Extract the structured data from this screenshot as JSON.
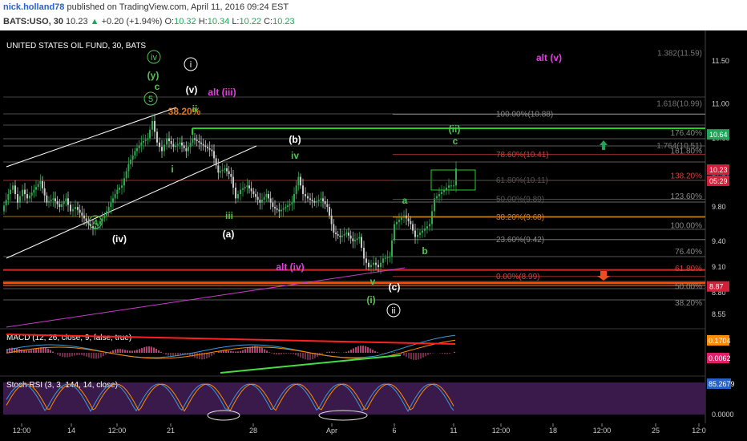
{
  "header": {
    "author": "nick.holland78",
    "published_text": "published on TradingView.com, April 11, 2016 09:24 EST",
    "symbol": "BATS:USO, 30",
    "last": "10.23",
    "change_arrow": "▲",
    "change": "+0.20 (+1.94%)",
    "o_label": "O:",
    "o": "10.32",
    "h_label": "H:",
    "h": "10.34",
    "l_label": "L:",
    "l": "10.22",
    "c_label": "C:",
    "c": "10.23"
  },
  "chart_data": {
    "type": "candlestick",
    "title": "UNITED STATES OIL FUND, 30, BATS",
    "y_ticks": [
      "11.50",
      "11.00",
      "10.60",
      "10.20",
      "9.80",
      "9.40",
      "9.10",
      "8.80",
      "8.55"
    ],
    "x_ticks": [
      "12:00",
      "14",
      "12:00",
      "21",
      "28",
      "Apr",
      "6",
      "11",
      "12:00",
      "18",
      "12:00",
      "25",
      "12:0"
    ],
    "price_path": [
      [
        0,
        9.75
      ],
      [
        8,
        9.95
      ],
      [
        14,
        10.05
      ],
      [
        20,
        9.85
      ],
      [
        26,
        10.0
      ],
      [
        32,
        9.9
      ],
      [
        40,
        10.0
      ],
      [
        48,
        10.1
      ],
      [
        56,
        9.85
      ],
      [
        64,
        9.9
      ],
      [
        72,
        9.8
      ],
      [
        80,
        9.9
      ],
      [
        86,
        9.75
      ],
      [
        92,
        9.8
      ],
      [
        100,
        9.7
      ],
      [
        108,
        9.6
      ],
      [
        114,
        9.55
      ],
      [
        120,
        9.6
      ],
      [
        128,
        9.7
      ],
      [
        136,
        9.85
      ],
      [
        144,
        10.0
      ],
      [
        150,
        10.05
      ],
      [
        158,
        10.3
      ],
      [
        166,
        10.45
      ],
      [
        174,
        10.55
      ],
      [
        182,
        10.6
      ],
      [
        188,
        10.8
      ],
      [
        194,
        10.55
      ],
      [
        200,
        10.45
      ],
      [
        206,
        10.6
      ],
      [
        214,
        10.5
      ],
      [
        222,
        10.55
      ],
      [
        230,
        10.45
      ],
      [
        238,
        10.6
      ],
      [
        246,
        10.55
      ],
      [
        254,
        10.5
      ],
      [
        262,
        10.45
      ],
      [
        270,
        10.2
      ],
      [
        278,
        10.25
      ],
      [
        286,
        10.15
      ],
      [
        292,
        9.9
      ],
      [
        298,
        10.0
      ],
      [
        306,
        10.05
      ],
      [
        314,
        9.95
      ],
      [
        322,
        9.85
      ],
      [
        330,
        9.95
      ],
      [
        338,
        9.8
      ],
      [
        346,
        9.75
      ],
      [
        354,
        9.8
      ],
      [
        362,
        9.85
      ],
      [
        370,
        10.15
      ],
      [
        376,
        9.95
      ],
      [
        382,
        9.9
      ],
      [
        390,
        9.85
      ],
      [
        398,
        9.9
      ],
      [
        406,
        9.8
      ],
      [
        414,
        9.5
      ],
      [
        422,
        9.45
      ],
      [
        430,
        9.5
      ],
      [
        438,
        9.4
      ],
      [
        446,
        9.45
      ],
      [
        452,
        9.2
      ],
      [
        458,
        9.1
      ],
      [
        464,
        9.15
      ],
      [
        470,
        9.1
      ],
      [
        476,
        9.2
      ],
      [
        484,
        9.22
      ],
      [
        490,
        9.6
      ],
      [
        496,
        9.65
      ],
      [
        502,
        9.7
      ],
      [
        510,
        9.6
      ],
      [
        516,
        9.45
      ],
      [
        522,
        9.5
      ],
      [
        528,
        9.55
      ],
      [
        534,
        9.6
      ],
      [
        540,
        9.9
      ],
      [
        546,
        9.95
      ],
      [
        552,
        10.0
      ],
      [
        558,
        10.05
      ],
      [
        564,
        10.05
      ],
      [
        568,
        10.25
      ]
    ],
    "fib_levels": [
      {
        "label": "100.00%(10.88)",
        "price": 10.88,
        "color": "#8a8a8a"
      },
      {
        "label": "78.60%(10.41)",
        "price": 10.41,
        "color": "#d44040"
      },
      {
        "label": "61.80%(10.11)",
        "price": 10.11,
        "color": "#555555"
      },
      {
        "label": "50.00%(9.89)",
        "price": 9.89,
        "color": "#555555"
      },
      {
        "label": "38.20%(9.68)",
        "price": 9.68,
        "color": "#e07a1f"
      },
      {
        "label": "23.60%(9.42)",
        "price": 9.42,
        "color": "#888888"
      },
      {
        "label": "0.00%(8.99)",
        "price": 8.99,
        "color": "#d44040"
      }
    ],
    "right_fib_labels": [
      {
        "label": "1.382(11.59)",
        "price": 11.59,
        "color": "#777777"
      },
      {
        "label": "1.618(10.99)",
        "price": 11.0,
        "color": "#777777"
      },
      {
        "label": "1.764(10.51)",
        "price": 10.51,
        "color": "#777777"
      },
      {
        "label": "176.40%",
        "price": 10.66,
        "color": "#8a8a8a"
      },
      {
        "label": "161.80%",
        "price": 10.45,
        "color": "#8a8a8a"
      },
      {
        "label": "138.20%",
        "price": 10.16,
        "color": "#d44040"
      },
      {
        "label": "123.60%",
        "price": 9.92,
        "color": "#8a8a8a"
      },
      {
        "label": "100.00%",
        "price": 9.58,
        "color": "#8a8a8a"
      },
      {
        "label": "76.40%",
        "price": 9.28,
        "color": "#8a8a8a"
      },
      {
        "label": "61.80%",
        "price": 9.08,
        "color": "#d44040"
      },
      {
        "label": "50.00%",
        "price": 8.87,
        "color": "#8a8a8a"
      },
      {
        "label": "38.20%",
        "price": 8.68,
        "color": "#8a8a8a"
      }
    ],
    "price_tags": [
      {
        "label": "10.64",
        "price": 10.64,
        "color": "#21a35a"
      },
      {
        "label": "10.23",
        "price": 10.23,
        "color": "#d41f3a"
      },
      {
        "label": "05:29",
        "price": 10.1,
        "color": "#d41f3a"
      },
      {
        "label": "8.87",
        "price": 8.87,
        "color": "#d41f3a"
      }
    ],
    "wave_labels": [
      {
        "text": "iv",
        "x": 192,
        "y": 75,
        "color": "#55c255",
        "circle": true
      },
      {
        "text": "i",
        "x": 238,
        "y": 84,
        "color": "#ffffff",
        "circle": true
      },
      {
        "text": "(y)",
        "x": 191,
        "y": 98,
        "color": "#55c255",
        "circle": false
      },
      {
        "text": "c",
        "x": 196,
        "y": 112,
        "color": "#55c255",
        "circle": false
      },
      {
        "text": "5",
        "x": 188,
        "y": 127,
        "color": "#55c255",
        "circle": true
      },
      {
        "text": "(v)",
        "x": 239,
        "y": 116,
        "color": "#ffffff",
        "circle": false
      },
      {
        "text": "alt (iii)",
        "x": 277,
        "y": 119,
        "color": "#e23ee0",
        "circle": false
      },
      {
        "text": "38.20%",
        "x": 230,
        "y": 143,
        "color": "#e07a1f",
        "circle": false
      },
      {
        "text": "ii",
        "x": 243,
        "y": 140,
        "color": "#55c255",
        "circle": false
      },
      {
        "text": "alt (v)",
        "x": 685,
        "y": 76,
        "color": "#e23ee0",
        "circle": false
      },
      {
        "text": "(ii)",
        "x": 567,
        "y": 165,
        "color": "#55c255",
        "circle": false
      },
      {
        "text": "c",
        "x": 568,
        "y": 180,
        "color": "#55c255",
        "circle": false
      },
      {
        "text": "(b)",
        "x": 368,
        "y": 178,
        "color": "#ffffff",
        "circle": false
      },
      {
        "text": "iv",
        "x": 368,
        "y": 198,
        "color": "#55c255",
        "circle": false
      },
      {
        "text": "i",
        "x": 215,
        "y": 215,
        "color": "#55c255",
        "circle": false
      },
      {
        "text": "iii",
        "x": 286,
        "y": 273,
        "color": "#55c255",
        "circle": false
      },
      {
        "text": "4",
        "x": 119,
        "y": 281,
        "color": "#55c255",
        "circle": true
      },
      {
        "text": "a",
        "x": 505,
        "y": 254,
        "color": "#55c255",
        "circle": false
      },
      {
        "text": "(iv)",
        "x": 149,
        "y": 302,
        "color": "#ffffff",
        "circle": false
      },
      {
        "text": "(a)",
        "x": 285,
        "y": 296,
        "color": "#ffffff",
        "circle": false
      },
      {
        "text": "b",
        "x": 530,
        "y": 317,
        "color": "#55c255",
        "circle": false
      },
      {
        "text": "alt (iv)",
        "x": 362,
        "y": 337,
        "color": "#e23ee0",
        "circle": false
      },
      {
        "text": "v",
        "x": 465,
        "y": 355,
        "color": "#55c255",
        "circle": false
      },
      {
        "text": "(c)",
        "x": 492,
        "y": 362,
        "color": "#ffffff",
        "circle": false
      },
      {
        "text": "(i)",
        "x": 463,
        "y": 378,
        "color": "#55c255",
        "circle": false
      },
      {
        "text": "ii",
        "x": 491,
        "y": 391,
        "color": "#ffffff",
        "circle": true
      }
    ],
    "macd": {
      "label": "MACD (12, 26, close, 9, false, true)",
      "value1": "0.1704",
      "value1_color": "#ff8c00",
      "value2": "0.0062",
      "value2_color": "#e01f6a"
    },
    "stoch_rsi": {
      "label": "Stoch RSI (3, 3, 144, 14, close)",
      "value": "85.2679",
      "value_color": "#2962c7",
      "y_ticks": [
        "0.0000"
      ]
    }
  }
}
